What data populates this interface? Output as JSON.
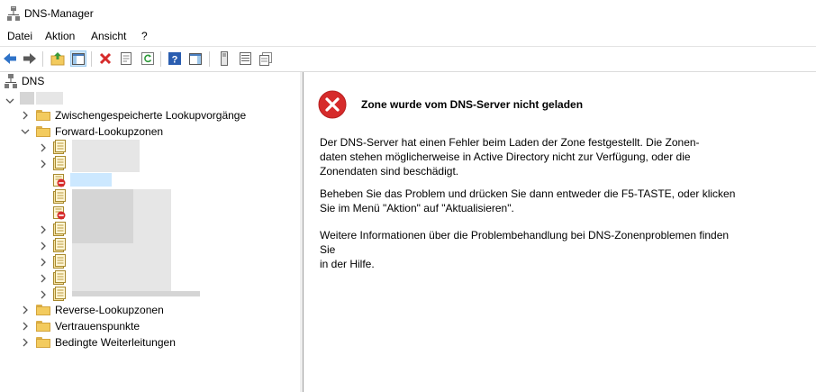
{
  "window": {
    "title": "DNS-Manager",
    "icon": "dns-server-icon"
  },
  "menu": [
    "Datei",
    "Aktion",
    "Ansicht",
    "?"
  ],
  "toolbar": [
    "back-icon",
    "forward-icon",
    "up-folder-icon",
    "show-hide-console-tree-icon",
    "delete-icon",
    "properties-icon",
    "refresh-icon",
    "help-icon",
    "show-action-pane-icon",
    "server-icon",
    "list-icon",
    "records-icon"
  ],
  "tree": {
    "root": "DNS",
    "items": {
      "cached": "Zwischengespeicherte Lookupvorgänge",
      "forward": "Forward-Lookupzonen",
      "reverse": "Reverse-Lookupzonen",
      "trust": "Vertrauenspunkte",
      "conditional": "Bedingte Weiterleitungen"
    }
  },
  "message": {
    "title": "Zone wurde vom DNS-Server nicht geladen",
    "p1_l1": "Der DNS-Server hat einen Fehler beim Laden der Zone festgestellt. Die Zonen-",
    "p1_l2": "daten stehen möglicherweise in Active Directory nicht zur Verfügung, oder die",
    "p1_l3": "Zonendaten sind beschädigt.",
    "p2_l1": "Beheben Sie das Problem und drücken Sie dann entweder die F5-TASTE, oder klicken",
    "p2_l2": "Sie im Menü \"Aktion\" auf \"Aktualisieren\".",
    "p3_l1": "Weitere Informationen über die Problembehandlung bei DNS-Zonenproblemen finden Sie",
    "p3_l2": "in der Hilfe."
  },
  "colors": {
    "error": "#d62b2b",
    "folder": "#f3cb5e",
    "selection": "#cce8ff",
    "back_arrow": "#2f73c8",
    "forward_arrow": "#5a5a5a"
  }
}
